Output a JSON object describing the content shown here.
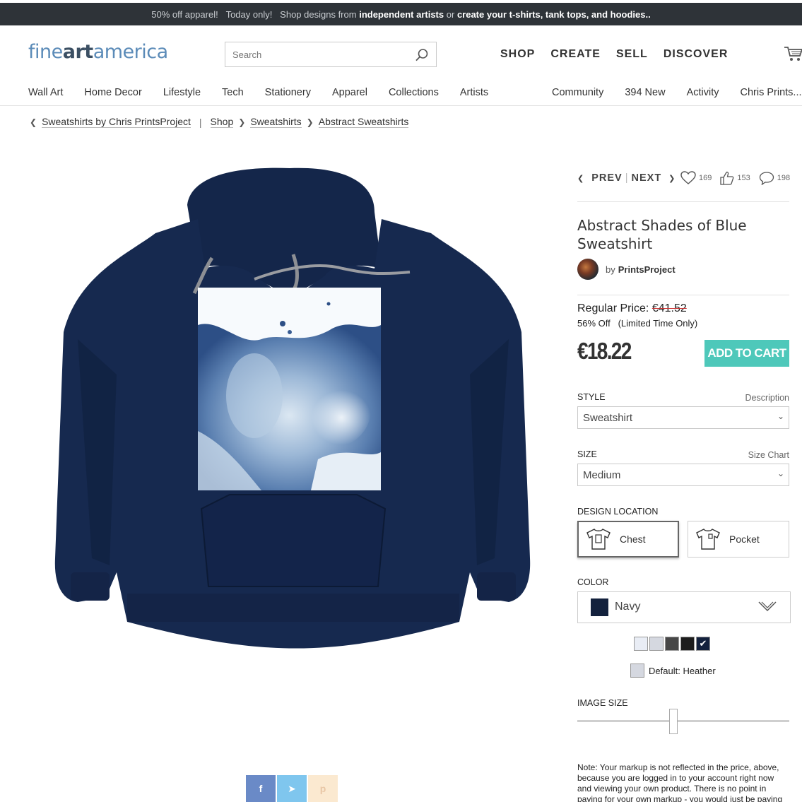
{
  "promo": {
    "p1": "50% off apparel!",
    "p2": "Today only!",
    "p3": "Shop designs from",
    "p4": "independent artists",
    "p5": "or",
    "p6": "create your t-shirts, tank tops, and hoodies.."
  },
  "logo": {
    "part1": "fine",
    "part2": "art",
    "part3": "america"
  },
  "search": {
    "placeholder": "Search"
  },
  "topnav": [
    "SHOP",
    "CREATE",
    "SELL",
    "DISCOVER"
  ],
  "subnav_left": [
    "Wall Art",
    "Home Decor",
    "Lifestyle",
    "Tech",
    "Stationery",
    "Apparel",
    "Collections",
    "Artists"
  ],
  "subnav_right": [
    "Community",
    "394 New",
    "Activity",
    "Chris Prints..."
  ],
  "breadcrumb": {
    "back": "Sweatshirts by Chris PrintsProject",
    "shop": "Shop",
    "cat": "Sweatshirts",
    "sub": "Abstract Sweatshirts"
  },
  "nav": {
    "prev": "PREV",
    "next": "NEXT",
    "favorites": "169",
    "likes": "153",
    "comments": "198"
  },
  "product": {
    "title": "Abstract Shades of Blue Sweatshirt",
    "by": "by",
    "artist": "PrintsProject",
    "regular_label": "Regular Price:",
    "regular_price": "€41.52",
    "discount": "56% Off   (Limited Time Only)",
    "price": "€18.22",
    "add_to_cart": "ADD TO CART"
  },
  "options": {
    "style_label": "STYLE",
    "style_link": "Description",
    "style_value": "Sweatshirt",
    "size_label": "SIZE",
    "size_link": "Size Chart",
    "size_value": "Medium",
    "location_label": "DESIGN LOCATION",
    "location_chest": "Chest",
    "location_pocket": "Pocket",
    "color_label": "COLOR",
    "color_value": "Navy",
    "color_hex": "#13213d",
    "default_label": "Default:",
    "default_value": "Heather",
    "image_size_label": "IMAGE SIZE",
    "image_size_level": 0.45
  },
  "note": "Note: Your markup is not reflected in the price, above, because you are logged in to your account right now and viewing your own product.   There is no point in paying for your own markup - you would just be paying"
}
